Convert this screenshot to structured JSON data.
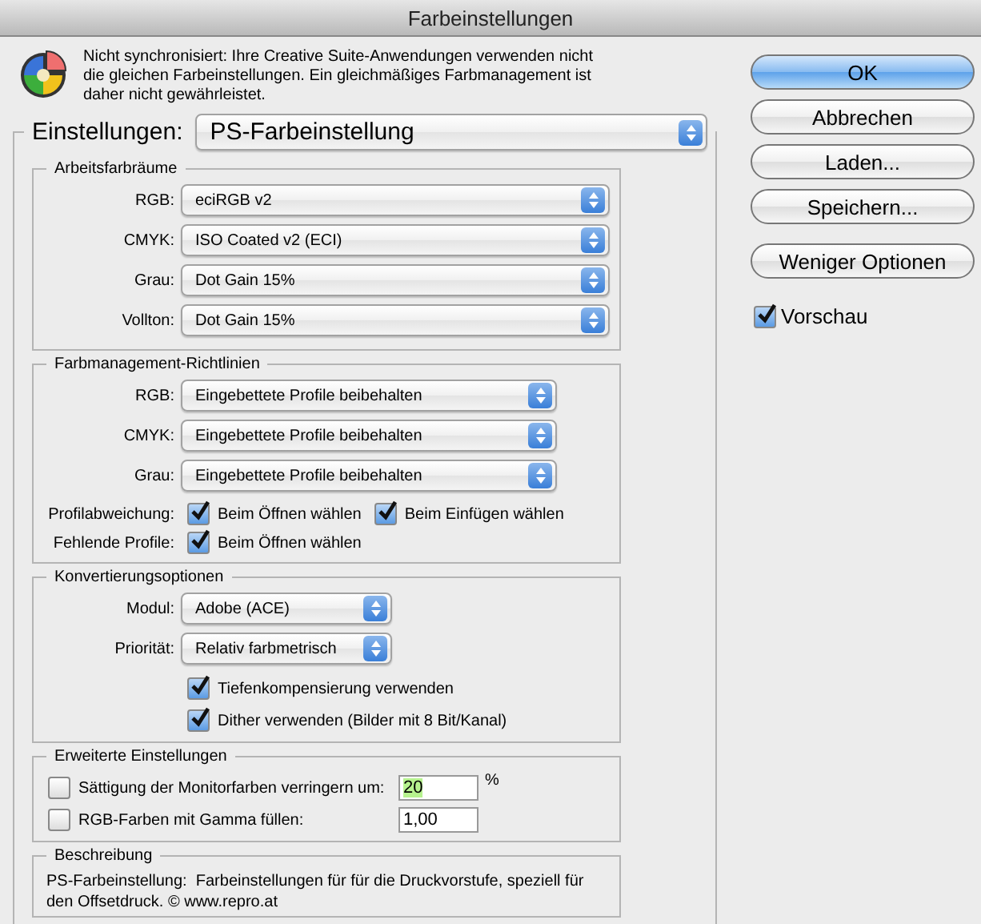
{
  "window": {
    "title": "Farbeinstellungen"
  },
  "message": "Nicht synchronisiert: Ihre Creative Suite-Anwendungen verwenden nicht die gleichen Farbeinstellungen. Ein gleichmäßiges Farbmanagement ist daher nicht gewährleistet.",
  "settings": {
    "label": "Einstellungen:",
    "value": "PS-Farbeinstellung"
  },
  "working_spaces": {
    "title": "Arbeitsfarbräume",
    "rows": [
      {
        "label": "RGB:",
        "value": "eciRGB v2"
      },
      {
        "label": "CMYK:",
        "value": "ISO Coated v2 (ECI)"
      },
      {
        "label": "Grau:",
        "value": "Dot Gain 15%"
      },
      {
        "label": "Vollton:",
        "value": "Dot Gain 15%"
      }
    ]
  },
  "policies": {
    "title": "Farbmanagement-Richtlinien",
    "rows": [
      {
        "label": "RGB:",
        "value": "Eingebettete Profile beibehalten"
      },
      {
        "label": "CMYK:",
        "value": "Eingebettete Profile beibehalten"
      },
      {
        "label": "Grau:",
        "value": "Eingebettete Profile beibehalten"
      }
    ],
    "checks": [
      {
        "label": "Profilabweichung:",
        "options": [
          {
            "label": "Beim Öffnen wählen",
            "checked": true
          },
          {
            "label": "Beim Einfügen wählen",
            "checked": true
          }
        ]
      },
      {
        "label": "Fehlende Profile:",
        "options": [
          {
            "label": "Beim Öffnen wählen",
            "checked": true
          }
        ]
      }
    ]
  },
  "conversion": {
    "title": "Konvertierungsoptionen",
    "rows": [
      {
        "label": "Modul:",
        "value": "Adobe (ACE)"
      },
      {
        "label": "Priorität:",
        "value": "Relativ farbmetrisch"
      }
    ],
    "options": [
      {
        "label": "Tiefenkompensierung verwenden",
        "checked": true
      },
      {
        "label": "Dither verwenden (Bilder mit 8 Bit/Kanal)",
        "checked": true
      }
    ]
  },
  "advanced": {
    "title": "Erweiterte Einstellungen",
    "rows": [
      {
        "label": "Sättigung der Monitorfarben verringern um:",
        "checked": false,
        "value": "20",
        "highlighted": true,
        "unit": "%"
      },
      {
        "label": "RGB-Farben mit Gamma füllen:",
        "checked": false,
        "value": "1,00",
        "highlighted": false
      }
    ]
  },
  "description": {
    "title": "Beschreibung",
    "text": "PS-Farbeinstellung:  Farbeinstellungen für für die Druckvorstufe, speziell für den Offsetdruck. © www.repro.at"
  },
  "buttons": [
    {
      "label": "OK",
      "default": true
    },
    {
      "label": "Abbrechen",
      "default": false
    },
    {
      "label": "Laden...",
      "default": false
    },
    {
      "label": "Speichern...",
      "default": false
    },
    {
      "label": "Weniger Optionen",
      "default": false
    }
  ],
  "preview": {
    "label": "Vorschau",
    "checked": true
  }
}
